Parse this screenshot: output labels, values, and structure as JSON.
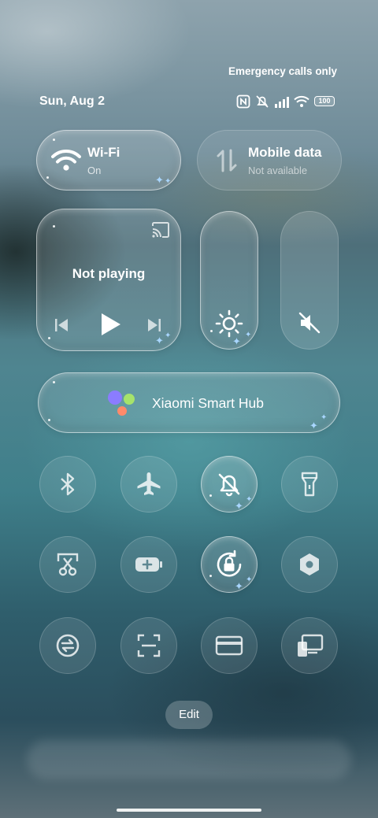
{
  "status": {
    "carrier": "Emergency calls only",
    "date": "Sun, Aug 2",
    "battery": "100"
  },
  "tiles": {
    "wifi": {
      "title": "Wi-Fi",
      "subtitle": "On"
    },
    "mobile": {
      "title": "Mobile data",
      "subtitle": "Not available"
    },
    "media": {
      "title": "Not playing"
    },
    "hub": {
      "title": "Xiaomi Smart Hub"
    }
  },
  "toggles": [
    {
      "icon": "bluetooth-icon"
    },
    {
      "icon": "airplane-icon"
    },
    {
      "icon": "silent-bell-icon",
      "active": true
    },
    {
      "icon": "flashlight-icon"
    },
    {
      "icon": "screenshot-icon"
    },
    {
      "icon": "battery-saver-icon"
    },
    {
      "icon": "rotation-lock-icon",
      "active": true
    },
    {
      "icon": "hexagon-icon"
    },
    {
      "icon": "sync-icon"
    },
    {
      "icon": "scan-icon"
    },
    {
      "icon": "card-icon"
    },
    {
      "icon": "cast-screen-icon"
    }
  ],
  "edit_label": "Edit"
}
